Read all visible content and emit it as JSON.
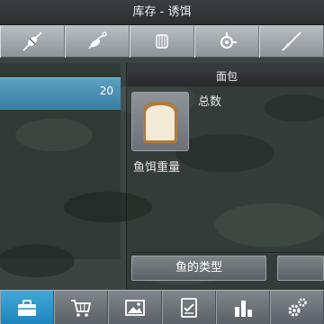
{
  "header": {
    "title": "库存 - 诱饵"
  },
  "category_tabs": [
    {
      "icon": "bobber-icon"
    },
    {
      "icon": "spinner-lure-icon"
    },
    {
      "icon": "fishing-line-icon"
    },
    {
      "icon": "reel-icon"
    },
    {
      "icon": "fishing-rod-icon"
    }
  ],
  "list": {
    "items": [
      {
        "count": "20"
      }
    ]
  },
  "detail": {
    "title": "面包",
    "total_label": "总数",
    "weight_label": "鱼饵重量",
    "item_icon": "bread-icon",
    "fish_type_button": "鱼的类型"
  },
  "bottom_nav": [
    {
      "icon": "toolbox-icon",
      "active": true
    },
    {
      "icon": "shopping-cart-icon",
      "active": false
    },
    {
      "icon": "picture-icon",
      "active": false
    },
    {
      "icon": "checklist-icon",
      "active": false
    },
    {
      "icon": "bar-chart-icon",
      "active": false
    },
    {
      "icon": "settings-gears-icon",
      "active": false
    }
  ],
  "colors": {
    "accent": "#2b95cc",
    "list_selected": "#4a90b3"
  }
}
